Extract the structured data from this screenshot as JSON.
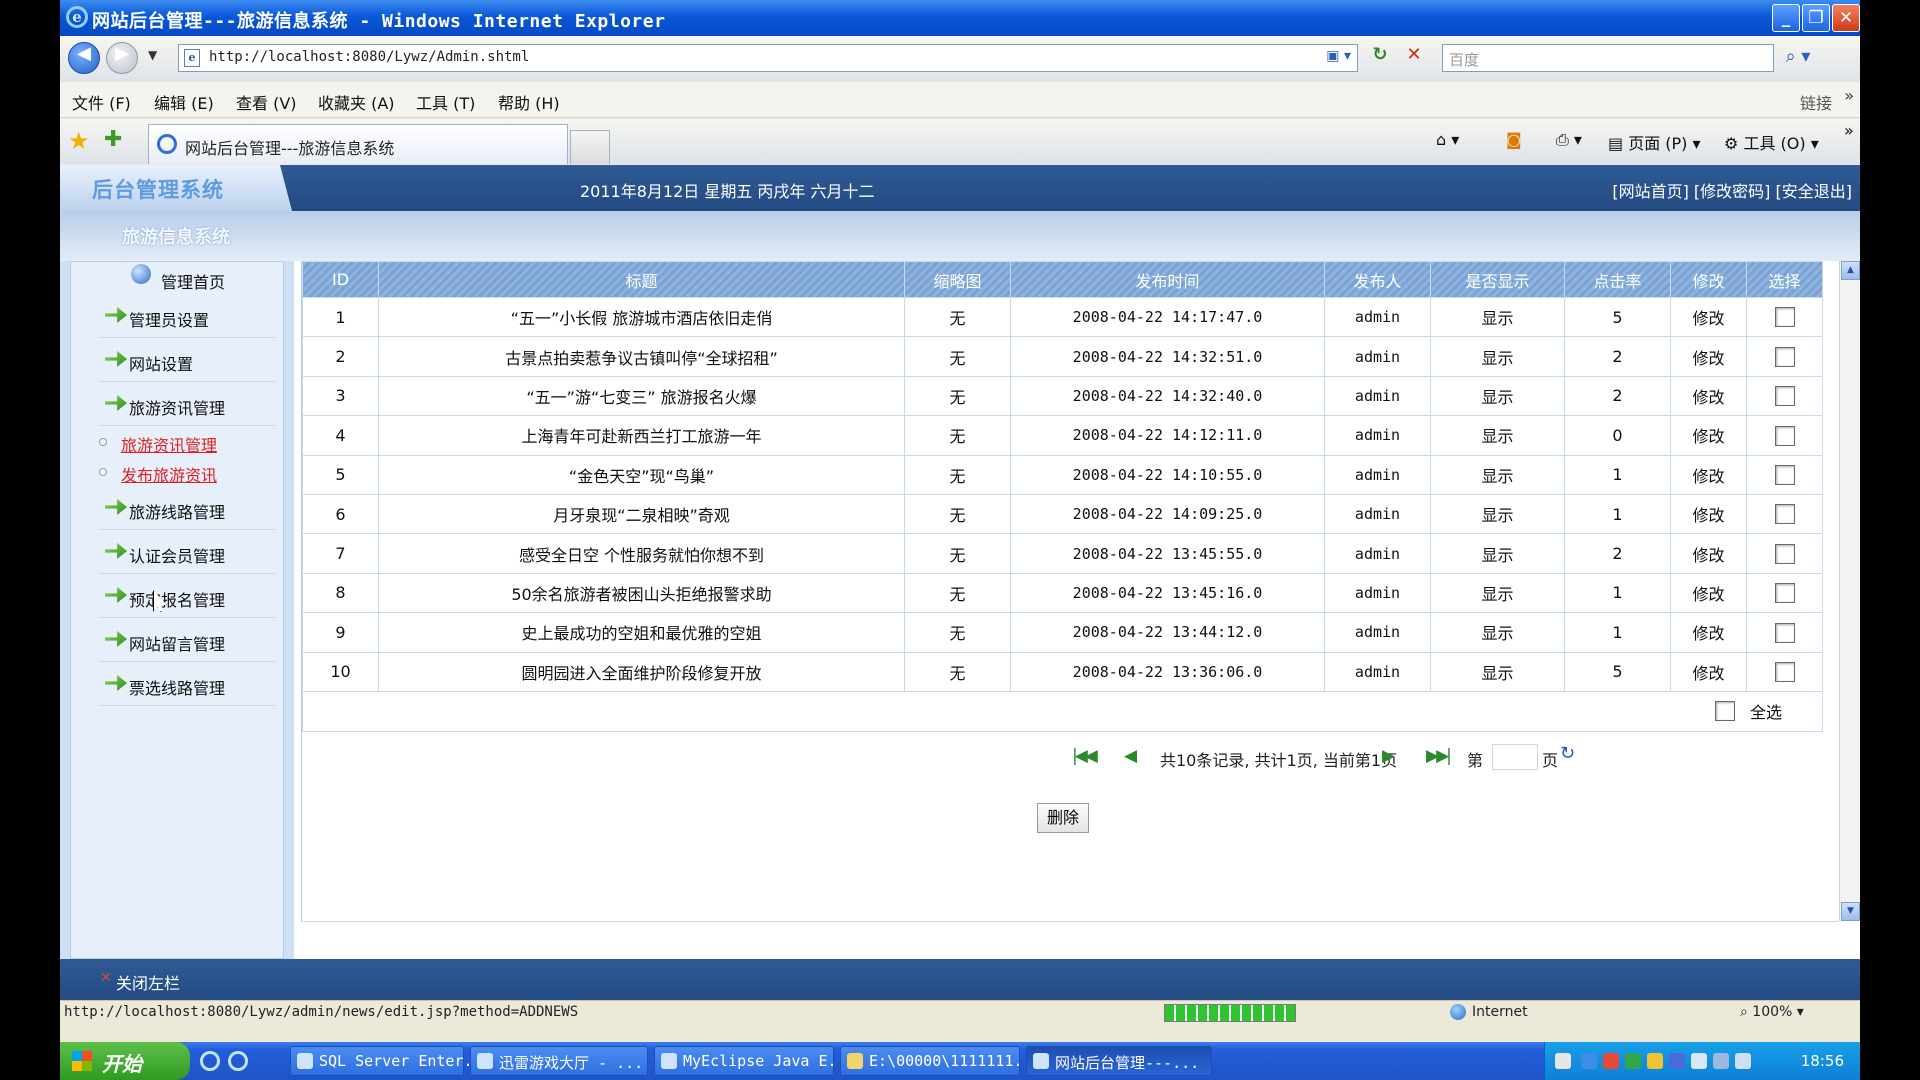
{
  "window": {
    "title": "网站后台管理---旅游信息系统 - Windows Internet Explorer",
    "min": "_",
    "max": "❐",
    "close": "✕"
  },
  "addressbar": {
    "url": "http://localhost:8080/Lywz/Admin.shtml",
    "search_placeholder": "百度"
  },
  "menubar": {
    "items": [
      "文件 (F)",
      "编辑 (E)",
      "查看 (V)",
      "收藏夹 (A)",
      "工具 (T)",
      "帮助 (H)"
    ],
    "links": "链接",
    "more": "»"
  },
  "tabbar": {
    "tab_label": "网站后台管理---旅游信息系统",
    "page_menu": "页面 (P)",
    "tools_menu": "工具 (O)"
  },
  "header": {
    "logo": "后台管理系统",
    "date": "2011年8月12日  星期五  丙戌年  六月十二",
    "links": "[网站首页] [修改密码] [安全退出]",
    "system_name": "旅游信息系统"
  },
  "sidebar": {
    "home": "管理首页",
    "items": [
      "管理员设置",
      "网站设置",
      "旅游资讯管理",
      "旅游线路管理",
      "认证会员管理",
      "预定报名管理",
      "网站留言管理",
      "票选线路管理"
    ],
    "subitems": [
      "旅游资讯管理",
      "发布旅游资讯"
    ],
    "close_left": "关闭左栏"
  },
  "table": {
    "columns": [
      "ID",
      "标题",
      "缩略图",
      "发布时间",
      "发布人",
      "是否显示",
      "点击率",
      "修改",
      "选择"
    ],
    "rows": [
      [
        "1",
        "“五一”小长假 旅游城市酒店依旧走俏",
        "无",
        "2008-04-22 14:17:47.0",
        "admin",
        "显示",
        "5",
        "修改"
      ],
      [
        "2",
        "古景点拍卖惹争议古镇叫停“全球招租”",
        "无",
        "2008-04-22 14:32:51.0",
        "admin",
        "显示",
        "2",
        "修改"
      ],
      [
        "3",
        "“五一”游“七变三” 旅游报名火爆",
        "无",
        "2008-04-22 14:32:40.0",
        "admin",
        "显示",
        "2",
        "修改"
      ],
      [
        "4",
        "上海青年可赴新西兰打工旅游一年",
        "无",
        "2008-04-22 14:12:11.0",
        "admin",
        "显示",
        "0",
        "修改"
      ],
      [
        "5",
        "“金色天空”现“鸟巢”",
        "无",
        "2008-04-22 14:10:55.0",
        "admin",
        "显示",
        "1",
        "修改"
      ],
      [
        "6",
        "月牙泉现“二泉相映”奇观",
        "无",
        "2008-04-22 14:09:25.0",
        "admin",
        "显示",
        "1",
        "修改"
      ],
      [
        "7",
        "感受全日空 个性服务就怕你想不到",
        "无",
        "2008-04-22 13:45:55.0",
        "admin",
        "显示",
        "2",
        "修改"
      ],
      [
        "8",
        "50余名旅游者被困山头拒绝报警求助",
        "无",
        "2008-04-22 13:45:16.0",
        "admin",
        "显示",
        "1",
        "修改"
      ],
      [
        "9",
        "史上最成功的空姐和最优雅的空姐",
        "无",
        "2008-04-22 13:44:12.0",
        "admin",
        "显示",
        "1",
        "修改"
      ],
      [
        "10",
        "圆明园进入全面维护阶段修复开放",
        "无",
        "2008-04-22 13:36:06.0",
        "admin",
        "显示",
        "5",
        "修改"
      ]
    ],
    "select_all": "全选"
  },
  "pager": {
    "info": "共10条记录, 共计1页, 当前第1页",
    "di": "第",
    "ye": "页"
  },
  "actions": {
    "delete": "删除"
  },
  "statusbar": {
    "url": "http://localhost:8080/Lywz/admin/news/edit.jsp?method=ADDNEWS",
    "zone": "Internet",
    "zoom": "100%"
  },
  "taskbar": {
    "start": "开始",
    "tasks": [
      "SQL Server Enter...",
      "迅雷游戏大厅 - ...",
      "MyEclipse Java E...",
      "E:\\00000\\1111111...",
      "网站后台管理---..."
    ],
    "clock": "18:56"
  }
}
